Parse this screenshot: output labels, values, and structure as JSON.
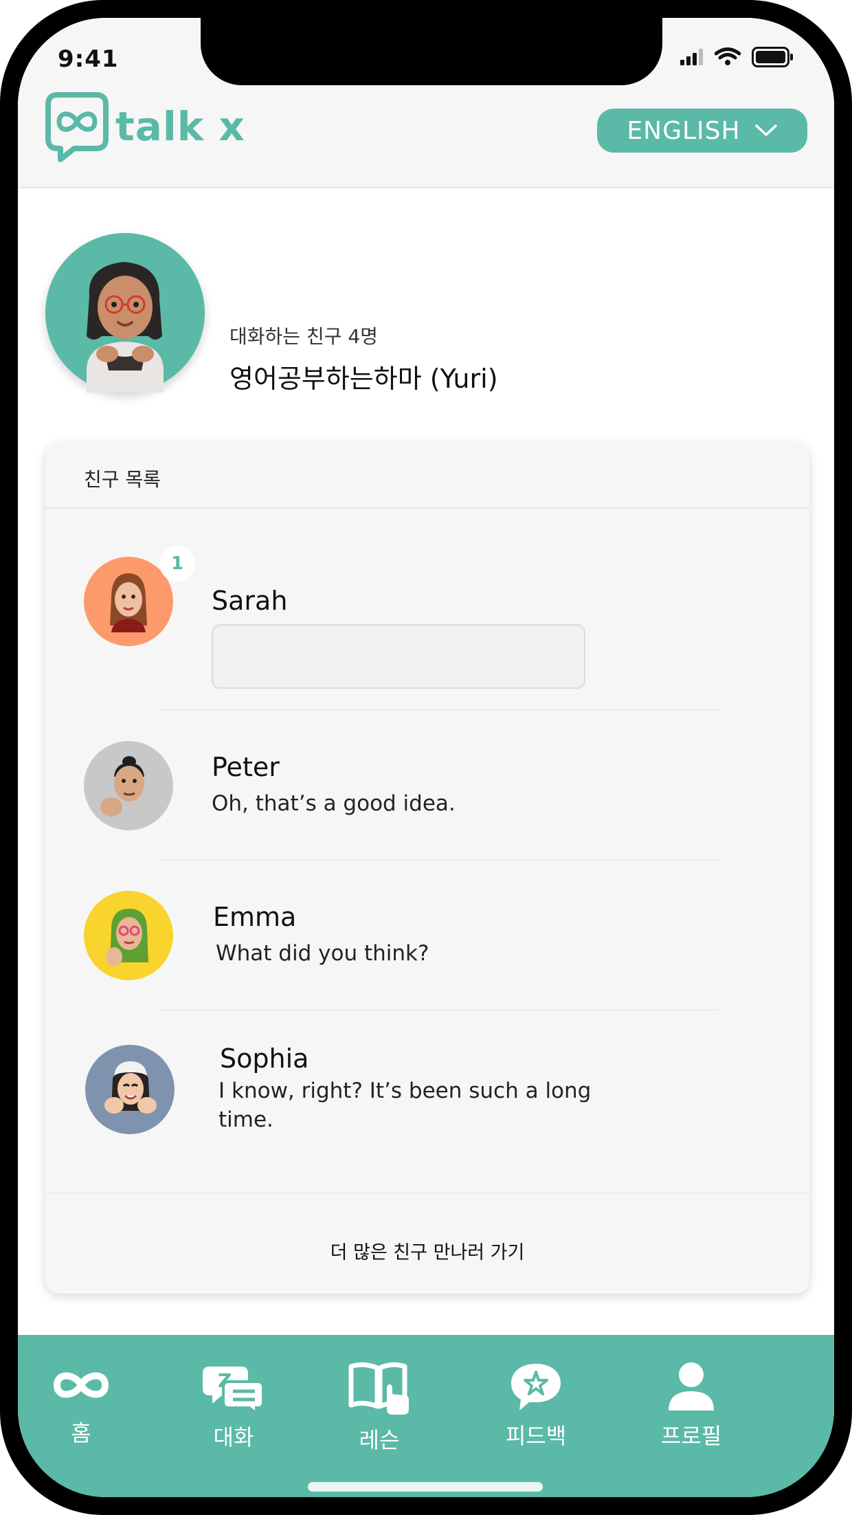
{
  "status_bar": {
    "time": "9:41"
  },
  "header": {
    "app_name": "talk x",
    "language_label": "ENGLISH"
  },
  "profile": {
    "friend_count_label": "대화하는 친구 4명",
    "name": "영어공부하는하마 (Yuri)"
  },
  "friends_card": {
    "title": "친구 목록",
    "friends": [
      {
        "name": "Sarah",
        "message": "",
        "unread": "1",
        "avatar_color": "#fc9a6c"
      },
      {
        "name": "Peter",
        "message": "Oh, that’s a good idea.",
        "avatar_color": "#c8c8c8"
      },
      {
        "name": "Emma",
        "message": "What did you think?",
        "avatar_color": "#f8d42c"
      },
      {
        "name": "Sophia",
        "message": "I know, right? It’s been such a long time.",
        "avatar_color": "#7f93ae"
      }
    ],
    "more_label": "더 많은 친구 만나러 가기"
  },
  "tabbar": {
    "tabs": [
      {
        "label": "홈",
        "icon": "infinity-icon"
      },
      {
        "label": "대화",
        "icon": "chat-icon"
      },
      {
        "label": "레슨",
        "icon": "book-icon"
      },
      {
        "label": "피드백",
        "icon": "star-bubble-icon"
      },
      {
        "label": "프로필",
        "icon": "person-icon"
      }
    ]
  },
  "colors": {
    "accent": "#5bb9a7",
    "background": "#f6f6f6"
  }
}
